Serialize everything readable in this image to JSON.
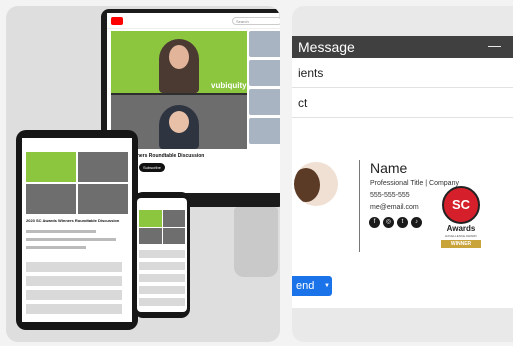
{
  "left": {
    "monitor": {
      "search_placeholder": "Search",
      "brand_overlay": "vubiquity",
      "video_title": "eards Winners Roundtable Discussion",
      "subscribe_label": "Subscribe"
    },
    "tablet": {
      "video_title": "2023 SC Awards Winners Roundtable Discussion"
    }
  },
  "right": {
    "compose": {
      "title": "Message",
      "minimize_icon": "—",
      "recipients_field": "ients",
      "subject_field": "ct",
      "send_label": "end"
    },
    "signature": {
      "name": "Name",
      "title_line": "Professional Title  |  Company",
      "phone": "555-555-555",
      "email": "me@email.com",
      "social_icons": [
        "facebook-icon",
        "instagram-icon",
        "twitter-icon",
        "tiktok-icon"
      ]
    },
    "award": {
      "badge": "SC",
      "label": "Awards",
      "sub": "EXCELLENCE AWARD",
      "ribbon": "WINNER"
    }
  },
  "colors": {
    "accent_green": "#8cc63f",
    "compose_header": "#404040",
    "send_blue": "#1a73e8",
    "award_red": "#d51f2b"
  }
}
